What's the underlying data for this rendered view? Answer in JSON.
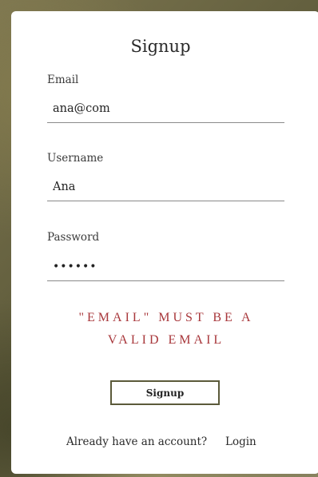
{
  "form": {
    "title": "Signup",
    "email": {
      "label": "Email",
      "value": "ana@com"
    },
    "username": {
      "label": "Username",
      "value": "Ana"
    },
    "password": {
      "label": "Password",
      "value": "••••••"
    },
    "error": "\"EMAIL\" MUST BE A VALID EMAIL",
    "submit_label": "Signup"
  },
  "footer": {
    "text": "Already have an account?",
    "login_label": "Login"
  },
  "colors": {
    "error": "#a8373b",
    "button_border": "#5b5a3a"
  }
}
